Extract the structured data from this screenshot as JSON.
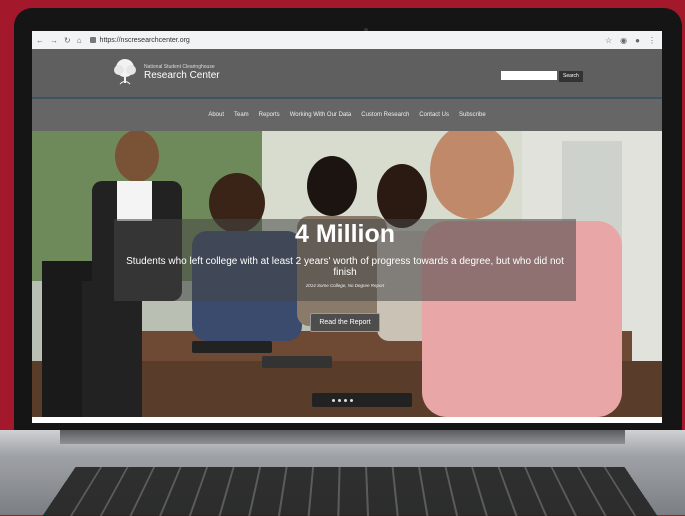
{
  "browser": {
    "url": "https://nscresearchcenter.org"
  },
  "header": {
    "logo_top": "National Student Clearinghouse",
    "logo_main": "Research Center",
    "search_placeholder": "",
    "search_label": "Search"
  },
  "nav": {
    "items": [
      "About",
      "Team",
      "Reports",
      "Working With Our Data",
      "Custom Research",
      "Contact Us",
      "Subscribe"
    ]
  },
  "hero": {
    "stat": "4 Million",
    "description": "Students who left college with at least 2 years' worth of progress towards a degree, but who did not finish",
    "source": "2014 Some College, No Degree Report",
    "button_label": "Read the Report",
    "slide_count": 4
  },
  "colors": {
    "background": "#a3192b",
    "header": "#5f5f5f",
    "nav": "#666666"
  }
}
